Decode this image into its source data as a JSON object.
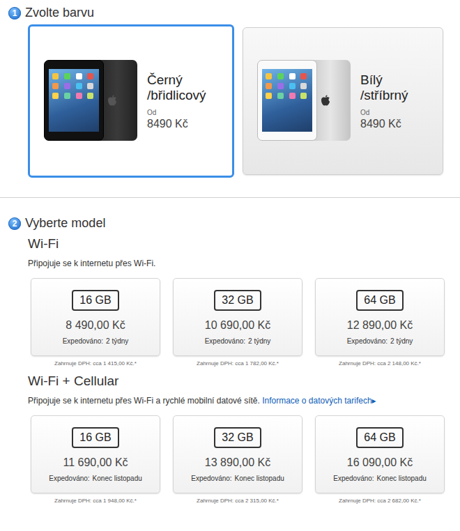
{
  "color_section": {
    "number": "1",
    "title": "Zvolte barvu",
    "options": [
      {
        "name_lines": [
          "Černý",
          "/břidlicový"
        ],
        "from_label": "Od",
        "price": "8490 Kč",
        "selected": true,
        "kind": "black"
      },
      {
        "name_lines": [
          "Bílý",
          "/stříbrný"
        ],
        "from_label": "Od",
        "price": "8490 Kč",
        "selected": false,
        "kind": "white"
      }
    ]
  },
  "model_section": {
    "number": "2",
    "title": "Vyberte model",
    "groups": [
      {
        "title": "Wi-Fi",
        "description": "Připojuje se k internetu přes Wi-Fi.",
        "models": [
          {
            "capacity": "16 GB",
            "price": "8 490,00 Kč",
            "shipping_label": "Expedováno:",
            "shipping": "2 týdny",
            "vat": "Zahrnuje DPH: cca 1 415,00 Kč.*"
          },
          {
            "capacity": "32 GB",
            "price": "10 690,00 Kč",
            "shipping_label": "Expedováno:",
            "shipping": "2 týdny",
            "vat": "Zahrnuje DPH: cca 1 782,00 Kč.*"
          },
          {
            "capacity": "64 GB",
            "price": "12 890,00 Kč",
            "shipping_label": "Expedováno:",
            "shipping": "2 týdny",
            "vat": "Zahrnuje DPH: cca 2 148,00 Kč.*"
          }
        ]
      },
      {
        "title": "Wi-Fi + Cellular",
        "description": "Připojuje se k internetu přes Wi-Fi a rychlé mobilní datové sítě.",
        "link": {
          "text": "Informace o datových tarifech",
          "arrow": "▸"
        },
        "models": [
          {
            "capacity": "16 GB",
            "price": "11 690,00 Kč",
            "shipping_label": "Expedováno:",
            "shipping": "Konec listopadu",
            "vat": "Zahrnuje DPH: cca 1 948,00 Kč.*"
          },
          {
            "capacity": "32 GB",
            "price": "13 890,00 Kč",
            "shipping_label": "Expedováno:",
            "shipping": "Konec listopadu",
            "vat": "Zahrnuje DPH: cca 2 315,00 Kč.*"
          },
          {
            "capacity": "64 GB",
            "price": "16 090,00 Kč",
            "shipping_label": "Expedováno:",
            "shipping": "Konec listopadu",
            "vat": "Zahrnuje DPH: cca 2 682,00 Kč.*"
          }
        ]
      }
    ]
  }
}
